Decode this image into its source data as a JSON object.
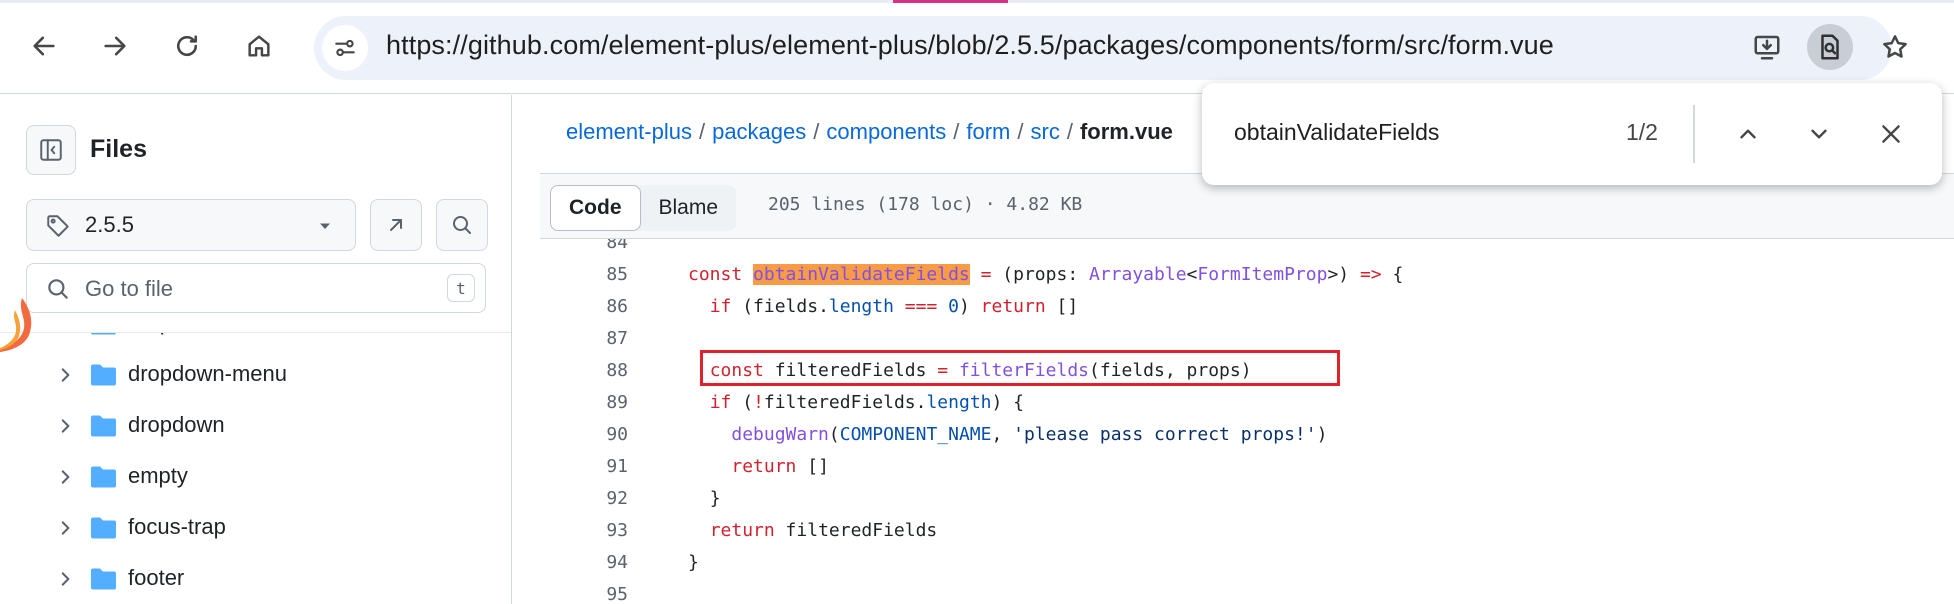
{
  "browser": {
    "url": "https://github.com/element-plus/element-plus/blob/2.5.5/packages/components/form/src/form.vue",
    "icons": [
      "back-icon",
      "forward-icon",
      "reload-icon",
      "home-icon",
      "site-info-icon",
      "install-icon",
      "find-icon",
      "bookmark-star-icon"
    ]
  },
  "find_bar": {
    "query": "obtainValidateFields",
    "count": "1/2"
  },
  "sidebar": {
    "title": "Files",
    "branch": "2.5.5",
    "goto_placeholder": "Go to file",
    "goto_shortcut": "t",
    "items": [
      {
        "label": "dropdown-item"
      },
      {
        "label": "dropdown-menu"
      },
      {
        "label": "dropdown"
      },
      {
        "label": "empty"
      },
      {
        "label": "focus-trap"
      },
      {
        "label": "footer"
      }
    ]
  },
  "breadcrumb": {
    "repo": "element-plus",
    "parts": [
      "packages",
      "components",
      "form",
      "src"
    ],
    "separator": "/",
    "current": "form.vue"
  },
  "code_toolbar": {
    "code_tab": "Code",
    "blame_tab": "Blame",
    "meta": "205 lines (178 loc) · 4.82 KB"
  },
  "code": {
    "lines": [
      {
        "num": "84"
      },
      {
        "num": "85"
      },
      {
        "num": "86"
      },
      {
        "num": "87"
      },
      {
        "num": "88"
      },
      {
        "num": "89"
      },
      {
        "num": "90"
      },
      {
        "num": "91"
      },
      {
        "num": "92"
      },
      {
        "num": "93"
      },
      {
        "num": "94"
      },
      {
        "num": "95"
      }
    ],
    "tokens": {
      "const": "const",
      "fn_obtain": "obtainValidateFields",
      "eq": " = ",
      "props_param": "(props: ",
      "arrayable": "Arrayable",
      "lt": "<",
      "formitemprop": "FormItemProp",
      "gt_paren": ">) ",
      "arrow": "=>",
      "brace_open": " {",
      "if": "if",
      "fields_open": " (fields.",
      "length": "length",
      "strict_eq": " === ",
      "zero": "0",
      "close_paren": ") ",
      "return": "return",
      "empty_arr": " []",
      "filtered_decl": " filteredFields ",
      "assign": "=",
      "filter_fn": " filterFields",
      "filter_args": "(fields, props)",
      "not_open": " (",
      "bang": "!",
      "filtered_len": "filteredFields.",
      "length2": "length",
      "close_brace_line": ") {",
      "debug_warn": "debugWarn",
      "paren_open": "(",
      "component_name": "COMPONENT_NAME",
      "comma": ", ",
      "warn_msg": "'please pass correct props!'",
      "paren_close": ")",
      "brace_close": "}",
      "filtered_ret": " filteredFields"
    }
  },
  "colors": {
    "link": "#0969da",
    "keyword": "#cf222e",
    "function": "#8250df",
    "constant": "#0550ae",
    "string": "#0a3069",
    "search_highlight": "#f79b46",
    "annotation_box": "#e0222c"
  }
}
